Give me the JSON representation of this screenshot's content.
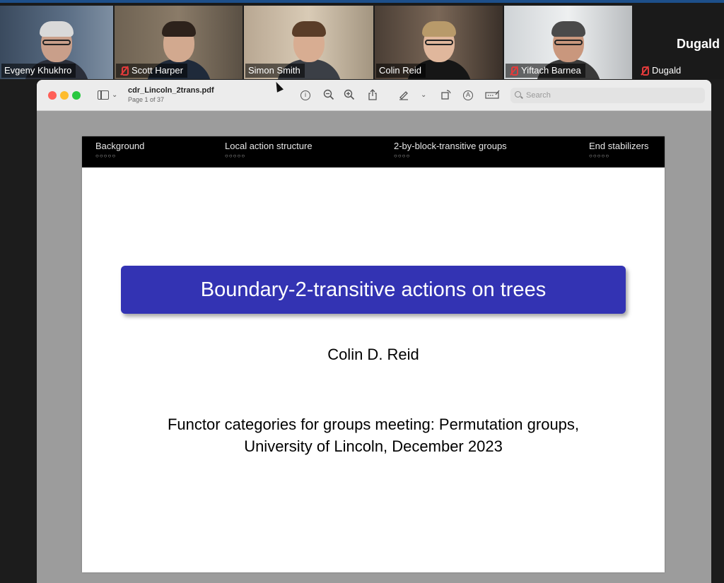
{
  "participants": [
    {
      "name": "Evgeny Khukhro",
      "muted": false
    },
    {
      "name": "Scott Harper",
      "muted": true
    },
    {
      "name": "Simon Smith",
      "muted": false,
      "active_speaker": true
    },
    {
      "name": "Colin Reid",
      "muted": false
    },
    {
      "name": "Yiftach Barnea",
      "muted": true
    },
    {
      "name": "Dugald",
      "muted": true,
      "camera_off": true,
      "display_name_large": "Dugald"
    }
  ],
  "pdf_viewer": {
    "file_name": "cdr_Lincoln_2trans.pdf",
    "page_indicator": "Page 1 of 37",
    "search_placeholder": "Search"
  },
  "slide": {
    "nav_sections": [
      {
        "label": "Background",
        "dots": "○○○○○"
      },
      {
        "label": "Local action structure",
        "dots": "○○○○○"
      },
      {
        "label": "2-by-block-transitive groups",
        "dots": "○○○○"
      },
      {
        "label": "End stabilizers",
        "dots": "○○○○○"
      }
    ],
    "title": "Boundary-2-transitive actions on trees",
    "author": "Colin D. Reid",
    "venue_line1": "Functor categories for groups meeting: Permutation groups,",
    "venue_line2": "University of Lincoln, December 2023"
  },
  "colors": {
    "title_box": "#3333b3",
    "active_speaker_border": "#7fbf3f",
    "mute_icon": "#e23b3b"
  }
}
